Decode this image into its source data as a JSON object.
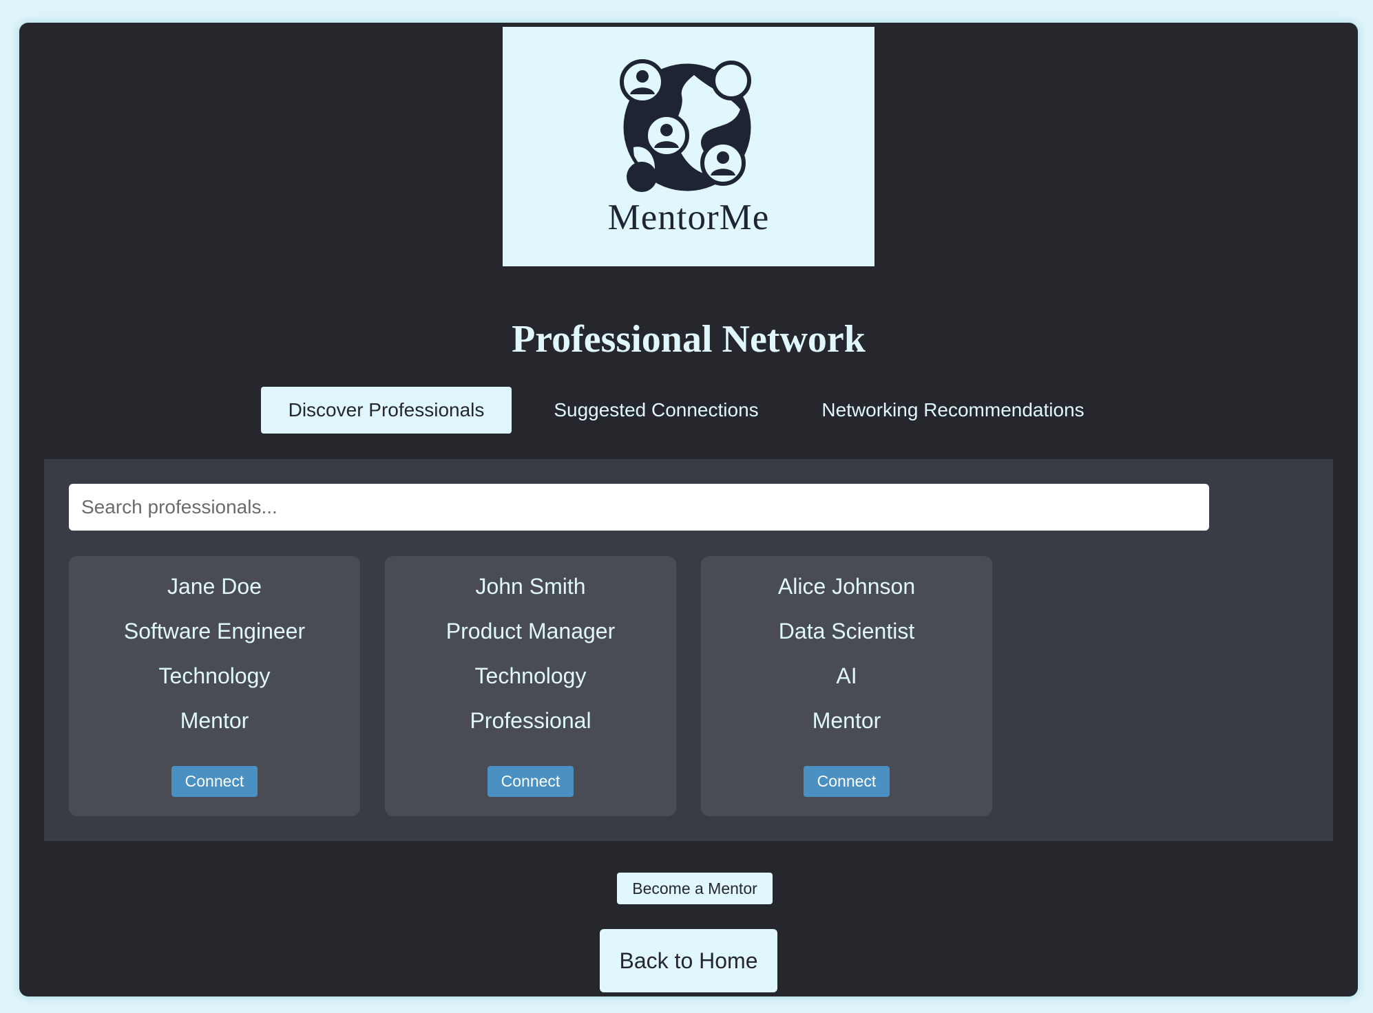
{
  "logo": {
    "text": "MentorMe",
    "icon": "globe-network-icon"
  },
  "page_title": "Professional Network",
  "tabs": [
    {
      "label": "Discover Professionals",
      "active": true
    },
    {
      "label": "Suggested Connections",
      "active": false
    },
    {
      "label": "Networking Recommendations",
      "active": false
    }
  ],
  "search": {
    "placeholder": "Search professionals...",
    "value": ""
  },
  "professionals": [
    {
      "name": "Jane Doe",
      "title": "Software Engineer",
      "industry": "Technology",
      "role": "Mentor",
      "button": "Connect"
    },
    {
      "name": "John Smith",
      "title": "Product Manager",
      "industry": "Technology",
      "role": "Professional",
      "button": "Connect"
    },
    {
      "name": "Alice Johnson",
      "title": "Data Scientist",
      "industry": "AI",
      "role": "Mentor",
      "button": "Connect"
    }
  ],
  "actions": {
    "become_mentor": "Become a Mentor",
    "back_home": "Back to Home"
  },
  "colors": {
    "background": "#dff5fb",
    "app_bg": "#25272d",
    "panel_bg": "#393c45",
    "card_bg": "#4a4c53",
    "accent_light": "#e0f7fd",
    "connect_button": "#4a90c2",
    "logo_ink": "#1e2433"
  }
}
